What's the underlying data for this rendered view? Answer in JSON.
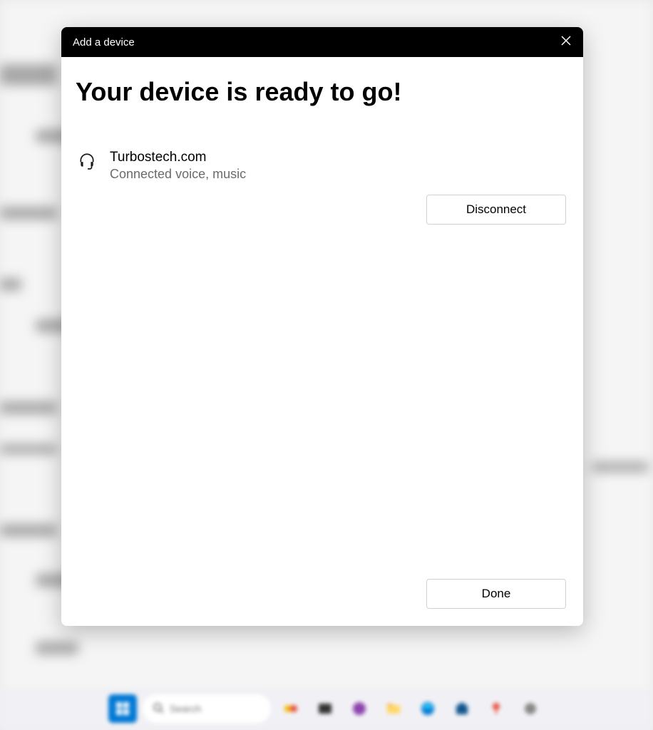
{
  "dialog": {
    "title": "Add a device",
    "headline": "Your device is ready to go!",
    "device": {
      "name": "Turbostech.com",
      "status": "Connected voice, music"
    },
    "disconnect_label": "Disconnect",
    "done_label": "Done"
  },
  "taskbar": {
    "search_placeholder": "Search"
  }
}
